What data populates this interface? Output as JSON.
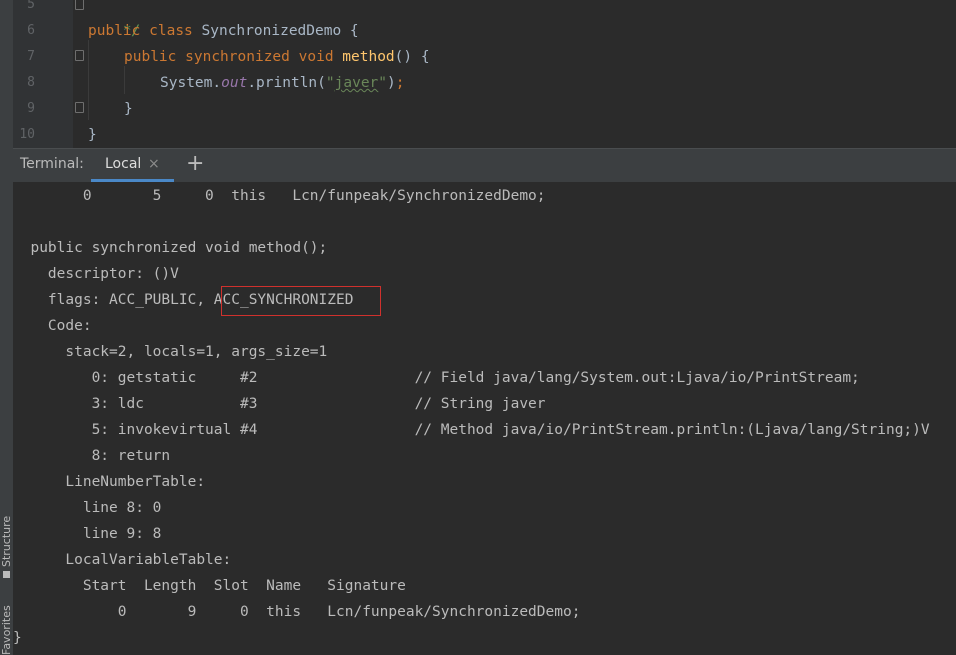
{
  "sidebar": {
    "structure_label": "Structure",
    "favorites_label": "Favorites"
  },
  "editor": {
    "line_numbers": [
      "5",
      "6",
      "7",
      "8",
      "9",
      "10"
    ],
    "line5": {
      "comment": "*/"
    },
    "line6": {
      "kw1": "public",
      "kw2": "class",
      "class_name": "SynchronizedDemo",
      "brace": " {"
    },
    "line7": {
      "kw1": "public",
      "kw2": "synchronized",
      "kw3": "void",
      "method_name": "method",
      "parens": "() {"
    },
    "line8": {
      "obj": "System.",
      "field": "out",
      "call": ".println(",
      "string_open": "\"",
      "string_body": "javer",
      "string_close": "\"",
      "close": ")",
      "semi": ";"
    },
    "line9": {
      "brace": "}"
    },
    "line10": {
      "brace": "}"
    }
  },
  "terminal": {
    "title": "Terminal:",
    "tab_label": "Local",
    "close_glyph": "×",
    "add_glyph": "+",
    "lines": [
      "        0       5     0  this   Lcn/funpeak/SynchronizedDemo;",
      "",
      "  public synchronized void method();",
      "    descriptor: ()V",
      "    flags: ACC_PUBLIC, ACC_SYNCHRONIZED",
      "    Code:",
      "      stack=2, locals=1, args_size=1",
      "         0: getstatic     #2                  // Field java/lang/System.out:Ljava/io/PrintStream;",
      "         3: ldc           #3                  // String javer",
      "         5: invokevirtual #4                  // Method java/io/PrintStream.println:(Ljava/lang/String;)V",
      "         8: return",
      "      LineNumberTable:",
      "        line 8: 0",
      "        line 9: 8",
      "      LocalVariableTable:",
      "        Start  Length  Slot  Name   Signature",
      "            0       9     0  this   Lcn/funpeak/SynchronizedDemo;",
      "}"
    ]
  },
  "colors": {
    "background": "#2b2b2b",
    "keyword": "#cc7832",
    "method": "#ffc66d",
    "field": "#9876aa",
    "string": "#6a8759",
    "highlight_box": "#d0312d",
    "tab_underline": "#4a88c7"
  }
}
